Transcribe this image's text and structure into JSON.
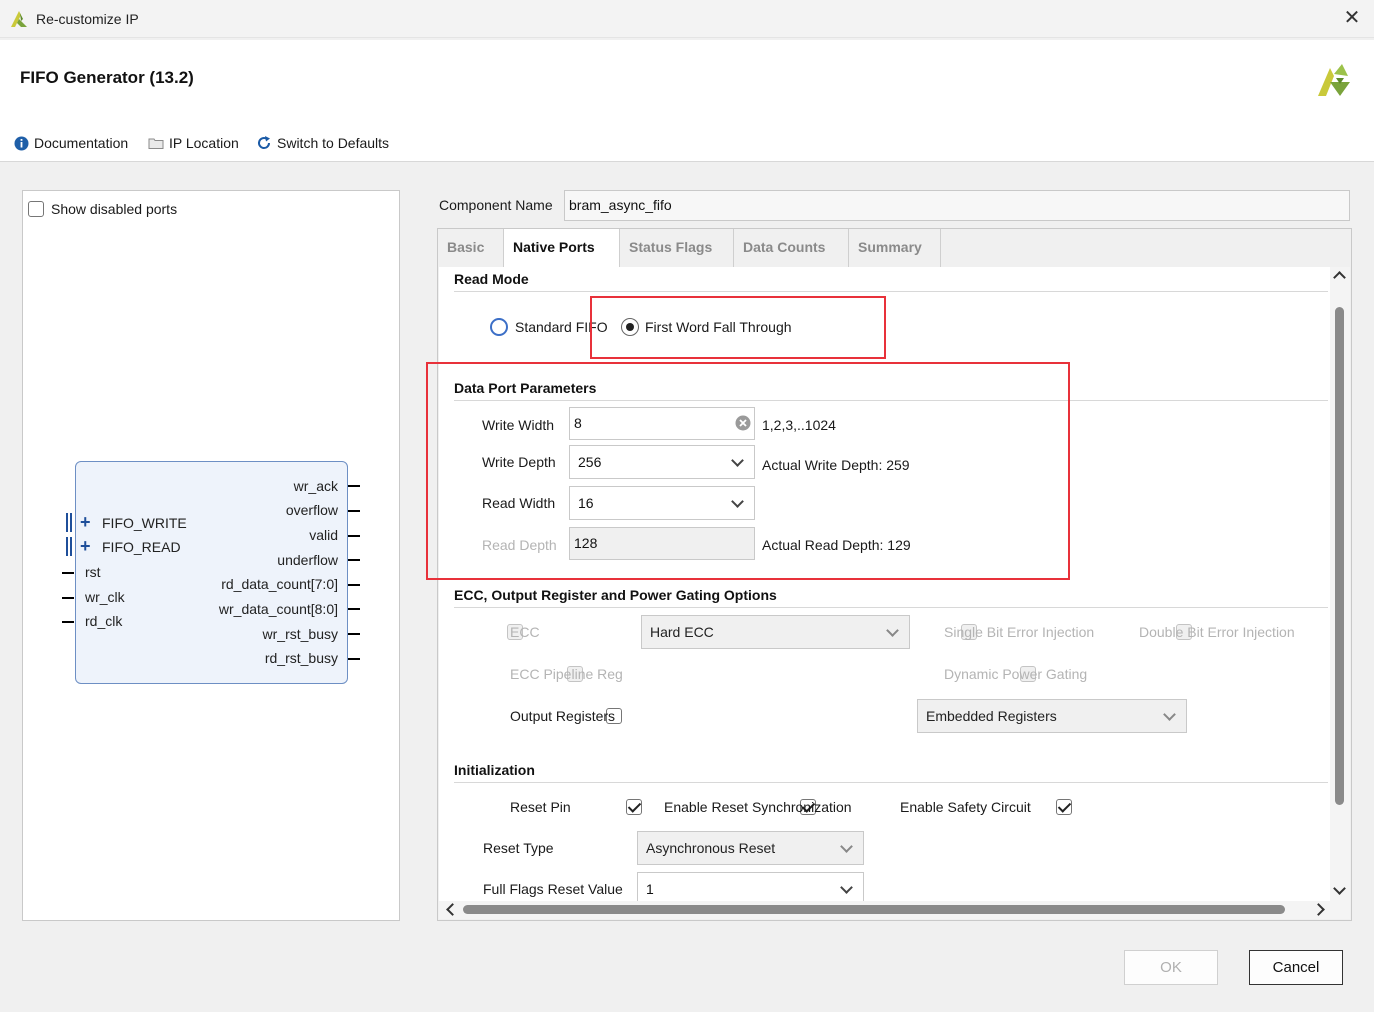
{
  "window": {
    "title": "Re-customize IP",
    "close_glyph": "✕"
  },
  "header": {
    "ip_title": "FIFO Generator (13.2)"
  },
  "toolbar": {
    "documentation": "Documentation",
    "ip_location": "IP Location",
    "switch_defaults": "Switch to Defaults"
  },
  "left_panel": {
    "show_disabled_label": "Show disabled ports",
    "show_disabled_checked": false,
    "left_ports": [
      "FIFO_WRITE",
      "FIFO_READ",
      "rst",
      "wr_clk",
      "rd_clk"
    ],
    "right_ports": [
      "wr_ack",
      "overflow",
      "valid",
      "underflow",
      "rd_data_count[7:0]",
      "wr_data_count[8:0]",
      "wr_rst_busy",
      "rd_rst_busy"
    ]
  },
  "component": {
    "label": "Component Name",
    "value": "bram_async_fifo"
  },
  "tabs": [
    {
      "label": "Basic",
      "active": false
    },
    {
      "label": "Native Ports",
      "active": true
    },
    {
      "label": "Status Flags",
      "active": false
    },
    {
      "label": "Data Counts",
      "active": false
    },
    {
      "label": "Summary",
      "active": false
    }
  ],
  "read_mode": {
    "heading": "Read Mode",
    "standard": "Standard FIFO",
    "fwft": "First Word Fall Through",
    "selected": "First Word Fall Through"
  },
  "data_port": {
    "heading": "Data Port Parameters",
    "write_width_label": "Write Width",
    "write_width_value": "8",
    "write_width_range": "1,2,3,..1024",
    "write_depth_label": "Write Depth",
    "write_depth_value": "256",
    "actual_write_depth": "Actual Write Depth: 259",
    "read_width_label": "Read Width",
    "read_width_value": "16",
    "read_depth_label": "Read Depth",
    "read_depth_value": "128",
    "actual_read_depth": "Actual Read Depth: 129"
  },
  "ecc": {
    "heading": "ECC, Output Register and Power Gating Options",
    "ecc_label": "ECC",
    "ecc_type": "Hard ECC",
    "single_bit": "Single Bit Error Injection",
    "double_bit": "Double Bit Error Injection",
    "ecc_pipeline": "ECC Pipeline Reg",
    "dynamic_power": "Dynamic Power Gating",
    "output_registers": "Output Registers",
    "output_reg_type": "Embedded Registers"
  },
  "init": {
    "heading": "Initialization",
    "reset_pin": "Reset Pin",
    "enable_reset_sync": "Enable Reset Synchronization",
    "enable_safety": "Enable Safety Circuit",
    "reset_type_label": "Reset Type",
    "reset_type_value": "Asynchronous Reset",
    "full_flags_label": "Full Flags Reset Value",
    "full_flags_value": "1"
  },
  "buttons": {
    "ok": "OK",
    "cancel": "Cancel"
  },
  "colors": {
    "highlight_red": "#e8313a",
    "radio_blue": "#3c6fc7",
    "xilinx_green": "#7aa33b",
    "xilinx_yellow": "#c9c93a"
  },
  "icons": [
    "xilinx-logo-icon",
    "info-icon",
    "folder-icon",
    "refresh-icon",
    "close-icon",
    "clear-field-icon",
    "chevron-down-icon",
    "bus-plus-icon"
  ]
}
